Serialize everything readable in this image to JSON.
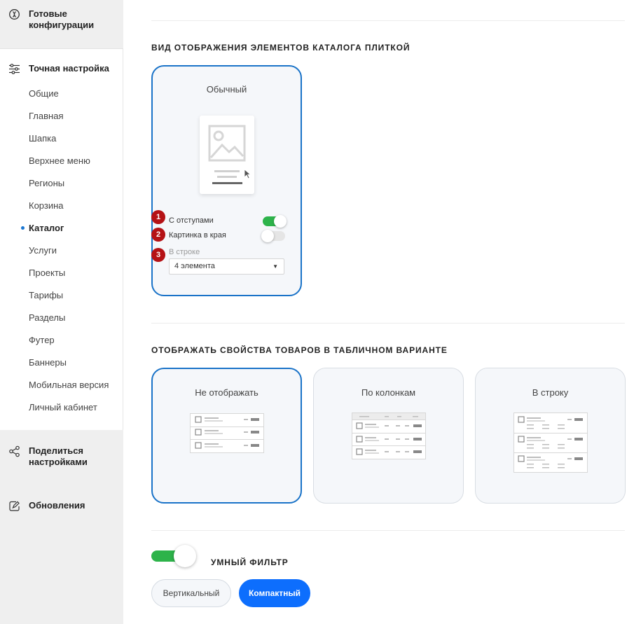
{
  "sidebar": {
    "ready_configs": "Готовые конфигурации",
    "fine_tuning": "Точная настройка",
    "items": [
      {
        "label": "Общие"
      },
      {
        "label": "Главная"
      },
      {
        "label": "Шапка"
      },
      {
        "label": "Верхнее меню"
      },
      {
        "label": "Регионы"
      },
      {
        "label": "Корзина"
      },
      {
        "label": "Каталог"
      },
      {
        "label": "Услуги"
      },
      {
        "label": "Проекты"
      },
      {
        "label": "Тарифы"
      },
      {
        "label": "Разделы"
      },
      {
        "label": "Футер"
      },
      {
        "label": "Баннеры"
      },
      {
        "label": "Мобильная версия"
      },
      {
        "label": "Личный кабинет"
      }
    ],
    "active_item": "Каталог",
    "share_settings": "Поделиться настройками",
    "updates": "Обновления"
  },
  "tile_section": {
    "title": "ВИД ОТОБРАЖЕНИЯ ЭЛЕМЕНТОВ КАТАЛОГА ПЛИТКОЙ",
    "card_title": "Обычный",
    "options": [
      {
        "badge": "1",
        "label": "С отступами",
        "enabled": true
      },
      {
        "badge": "2",
        "label": "Картинка в края",
        "enabled": false
      },
      {
        "badge": "3",
        "label": "В строке"
      }
    ],
    "per_row_value": "4 элемента"
  },
  "props_section": {
    "title": "ОТОБРАЖАТЬ СВОЙСТВА ТОВАРОВ В ТАБЛИЧНОМ ВАРИАНТЕ",
    "cards": [
      {
        "label": "Не отображать",
        "selected": true
      },
      {
        "label": "По колонкам",
        "selected": false
      },
      {
        "label": "В строку",
        "selected": false
      }
    ]
  },
  "smart_filter": {
    "title": "УМНЫЙ ФИЛЬТР",
    "enabled": true,
    "modes": [
      {
        "label": "Вертикальный",
        "selected": false
      },
      {
        "label": "Компактный",
        "selected": true
      }
    ]
  },
  "colors": {
    "accent": "#1a73c8",
    "toggle_on": "#2db34a",
    "badge": "#b51216",
    "primary_button": "#0d6efd"
  }
}
